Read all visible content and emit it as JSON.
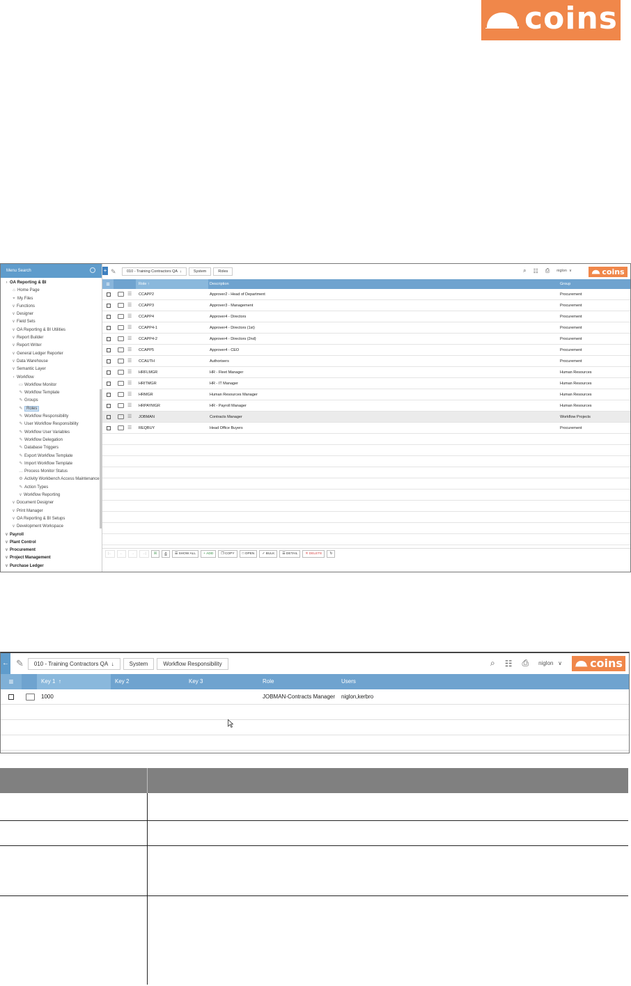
{
  "brand": {
    "logo_text": "coins",
    "accent_color": "#f0874a",
    "header_color": "#6fa3cf"
  },
  "roles_screen": {
    "menu_search_label": "Menu Search",
    "tree": [
      {
        "label": "OA Reporting & BI",
        "level": 0,
        "bold": true,
        "chev": ">"
      },
      {
        "label": "Home Page",
        "level": 1,
        "icon": "home-icon"
      },
      {
        "label": "My Files",
        "level": 1,
        "icon": "pin-icon"
      },
      {
        "label": "Functions",
        "level": 1,
        "chev": "v"
      },
      {
        "label": "Designer",
        "level": 1,
        "chev": "v"
      },
      {
        "label": "Field Sets",
        "level": 1,
        "chev": "v"
      },
      {
        "label": "OA Reporting & BI Utilities",
        "level": 1,
        "chev": "v"
      },
      {
        "label": "Report Builder",
        "level": 1,
        "chev": "v"
      },
      {
        "label": "Report Writer",
        "level": 1,
        "chev": "v"
      },
      {
        "label": "General Ledger Reporter",
        "level": 1,
        "chev": "v"
      },
      {
        "label": "Data Warehouse",
        "level": 1,
        "chev": "v"
      },
      {
        "label": "Semantic Layer",
        "level": 1,
        "chev": "v"
      },
      {
        "label": "Workflow",
        "level": 1,
        "chev": ">"
      },
      {
        "label": "Workflow Monitor",
        "level": 2,
        "icon": "monitor-icon"
      },
      {
        "label": "Workflow Template",
        "level": 2,
        "icon": "wrench-icon"
      },
      {
        "label": "Groups",
        "level": 2,
        "icon": "wrench-icon"
      },
      {
        "label": "Roles",
        "level": 2,
        "icon": "wrench-icon",
        "selected": true
      },
      {
        "label": "Workflow Responsibility",
        "level": 2,
        "icon": "wrench-icon"
      },
      {
        "label": "User Workflow Responsibility",
        "level": 2,
        "icon": "wrench-icon"
      },
      {
        "label": "Workflow User Variables",
        "level": 2,
        "icon": "wrench-icon"
      },
      {
        "label": "Workflow Delegation",
        "level": 2,
        "icon": "wrench-icon"
      },
      {
        "label": "Database Triggers",
        "level": 2,
        "icon": "wrench-icon"
      },
      {
        "label": "Export Workflow Template",
        "level": 2,
        "icon": "wrench-icon"
      },
      {
        "label": "Import Workflow Template",
        "level": 2,
        "icon": "wrench-icon"
      },
      {
        "label": "Process Monitor Status",
        "level": 2,
        "icon": "status-icon"
      },
      {
        "label": "Activity Workbench Access Maintenance",
        "level": 2,
        "icon": "gear-icon"
      },
      {
        "label": "Action Types",
        "level": 2,
        "icon": "wrench-icon"
      },
      {
        "label": "Workflow Reporting",
        "level": 2,
        "chev": "v"
      },
      {
        "label": "Document Designer",
        "level": 1,
        "chev": "v"
      },
      {
        "label": "Print Manager",
        "level": 1,
        "chev": "v"
      },
      {
        "label": "OA Reporting & BI Setups",
        "level": 1,
        "chev": "v"
      },
      {
        "label": "Development Workspace",
        "level": 1,
        "chev": "v"
      },
      {
        "label": "Payroll",
        "level": 0,
        "bold": true,
        "chev": "v"
      },
      {
        "label": "Plant Control",
        "level": 0,
        "bold": true,
        "chev": "v"
      },
      {
        "label": "Procurement",
        "level": 0,
        "bold": true,
        "chev": "v"
      },
      {
        "label": "Project Management",
        "level": 0,
        "bold": true,
        "chev": "v"
      },
      {
        "label": "Purchase Ledger",
        "level": 0,
        "bold": true,
        "chev": "v"
      }
    ],
    "breadcrumbs": [
      "010 - Training Contractors QA",
      "System",
      "Roles"
    ],
    "user": "niglon",
    "columns": [
      "Role",
      "Description",
      "Group"
    ],
    "rows": [
      {
        "role": "CCAPP2",
        "description": "Approver2 - Head of Department",
        "group": "Procurement"
      },
      {
        "role": "CCAPP3",
        "description": "Approver3 - Management",
        "group": "Procurement"
      },
      {
        "role": "CCAPP4",
        "description": "Approver4 - Directors",
        "group": "Procurement"
      },
      {
        "role": "CCAPP4-1",
        "description": "Approver4 - Directors (1st)",
        "group": "Procurement"
      },
      {
        "role": "CCAPP4-2",
        "description": "Approver4 - Directors (2nd)",
        "group": "Procurement"
      },
      {
        "role": "CCAPP5",
        "description": "Approver4 - CEO",
        "group": "Procurement"
      },
      {
        "role": "CCAUTH",
        "description": "Authorisers",
        "group": "Procurement"
      },
      {
        "role": "HRFLMGR",
        "description": "HR - Fleet Manager",
        "group": "Human Resources"
      },
      {
        "role": "HRITMGR",
        "description": "HR - IT Manager",
        "group": "Human Resources"
      },
      {
        "role": "HRMGR",
        "description": "Human Resources Manager",
        "group": "Human Resources"
      },
      {
        "role": "HRPAYMGR",
        "description": "HR - Payroll Manager",
        "group": "Human Resources"
      },
      {
        "role": "JOBMAN",
        "description": "Contracts Manager",
        "group": "Workflow Projects",
        "highlight": true
      },
      {
        "role": "REQBUY",
        "description": "Head Office Buyers",
        "group": "Procurement"
      }
    ],
    "toolbar": {
      "show_all": "SHOW ALL",
      "add": "ADD",
      "copy": "COPY",
      "open": "OPEN",
      "bulk": "BULK",
      "detail": "DETAIL",
      "delete": "DELETE"
    }
  },
  "responsibility_screen": {
    "breadcrumbs": [
      "010 - Training Contractors QA",
      "System",
      "Workflow Responsibility"
    ],
    "user": "niglon",
    "columns": [
      "Key 1",
      "Key 2",
      "Key 3",
      "Role",
      "Users"
    ],
    "rows": [
      {
        "key1": "1000",
        "key2": "",
        "key3": "",
        "role": "JOBMAN-Contracts Manager",
        "users": "niglon,kerbro"
      }
    ]
  }
}
